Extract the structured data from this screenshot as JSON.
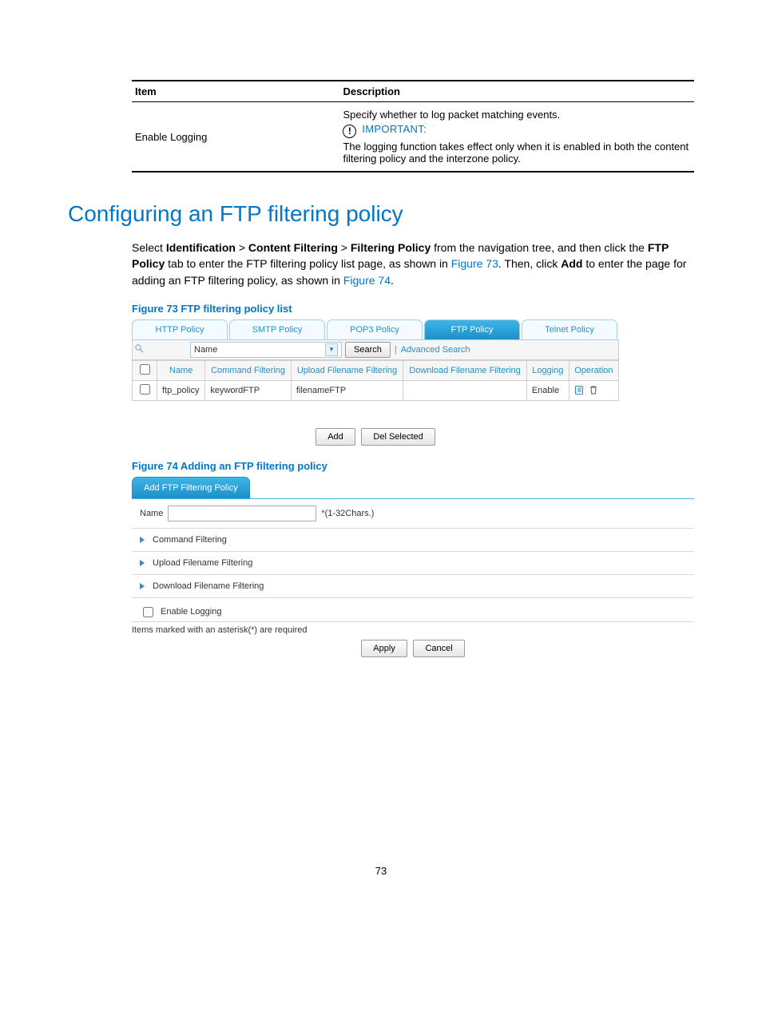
{
  "desc_table": {
    "header_item": "Item",
    "header_desc": "Description",
    "row_item": "Enable Logging",
    "desc_line1": "Specify whether to log packet matching events.",
    "important_label": "IMPORTANT:",
    "desc_line2": "The logging function takes effect only when it is enabled in both the content filtering policy and the interzone policy."
  },
  "heading": "Configuring an FTP filtering policy",
  "paragraph": {
    "pre": "Select ",
    "b1": "Identification",
    "gt1": " > ",
    "b2": "Content Filtering",
    "gt2": " > ",
    "b3": "Filtering Policy",
    "mid1": " from the navigation tree, and then click the ",
    "b4": "FTP Policy",
    "mid2": " tab to enter the FTP filtering policy list page, as shown in ",
    "fig73": "Figure 73",
    "mid3": ". Then, click ",
    "b5": "Add",
    "mid4": " to enter the page for adding an FTP filtering policy, as shown in ",
    "fig74": "Figure 74",
    "end": "."
  },
  "fig73": {
    "caption": "Figure 73 FTP filtering policy list",
    "tabs": [
      "HTTP Policy",
      "SMTP Policy",
      "POP3 Policy",
      "FTP Policy",
      "Telnet Policy"
    ],
    "active_tab_index": 3,
    "filter_field": "Name",
    "search_button": "Search",
    "advanced_search": "Advanced Search",
    "columns": [
      "Name",
      "Command Filtering",
      "Upload Filename Filtering",
      "Download Filename Filtering",
      "Logging",
      "Operation"
    ],
    "row": {
      "name": "ftp_policy",
      "command": "keywordFTP",
      "upload": "filenameFTP",
      "download": "",
      "logging": "Enable"
    },
    "buttons": {
      "add": "Add",
      "del": "Del Selected"
    }
  },
  "fig74": {
    "caption": "Figure 74 Adding an FTP filtering policy",
    "tab": "Add FTP Filtering Policy",
    "name_label": "Name",
    "name_hint": "(1-32Chars.)",
    "sections": [
      "Command Filtering",
      "Upload Filename Filtering",
      "Download Filename Filtering"
    ],
    "enable_logging": "Enable Logging",
    "required_note": "Items marked with an asterisk(*) are required",
    "buttons": {
      "apply": "Apply",
      "cancel": "Cancel"
    }
  },
  "page_number": "73"
}
